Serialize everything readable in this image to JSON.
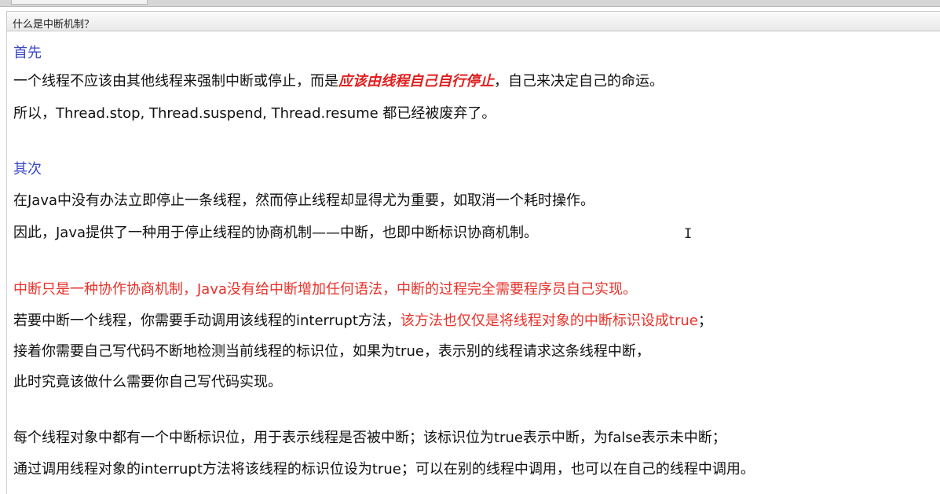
{
  "title": "什么是中断机制？",
  "section1": {
    "heading": "首先",
    "line1_a": "一个线程不应该由其他线程来强制中断或停止，而是",
    "line1_em": "应该由线程自己自行停止",
    "line1_b": "，自己来决定自己的命运。",
    "line2": "所以，Thread.stop, Thread.suspend, Thread.resume 都已经被废弃了。"
  },
  "section2": {
    "heading": "其次",
    "line1": "在Java中没有办法立即停止一条线程，然而停止线程却显得尤为重要，如取消一个耗时操作。",
    "line2": "因此，Java提供了一种用于停止线程的协商机制——中断，也即中断标识协商机制。"
  },
  "section3": {
    "red_line": "中断只是一种协作协商机制，Java没有给中断增加任何语法，中断的过程完全需要程序员自己实现。",
    "line1_a": "若要中断一个线程，你需要手动调用该线程的interrupt方法，",
    "line1_red": "该方法也仅仅是将线程对象的中断标识设成true",
    "line1_b": "；",
    "line2": "接着你需要自己写代码不断地检测当前线程的标识位，如果为true，表示别的线程请求这条线程中断，",
    "line3": "此时究竟该做什么需要你自己写代码实现。"
  },
  "section4": {
    "line1": "每个线程对象中都有一个中断标识位，用于表示线程是否被中断；该标识位为true表示中断，为false表示未中断；",
    "line2": "通过调用线程对象的interrupt方法将该线程的标识位设为true；可以在别的线程中调用，也可以在自己的线程中调用。"
  },
  "cursor_glyph": "I"
}
